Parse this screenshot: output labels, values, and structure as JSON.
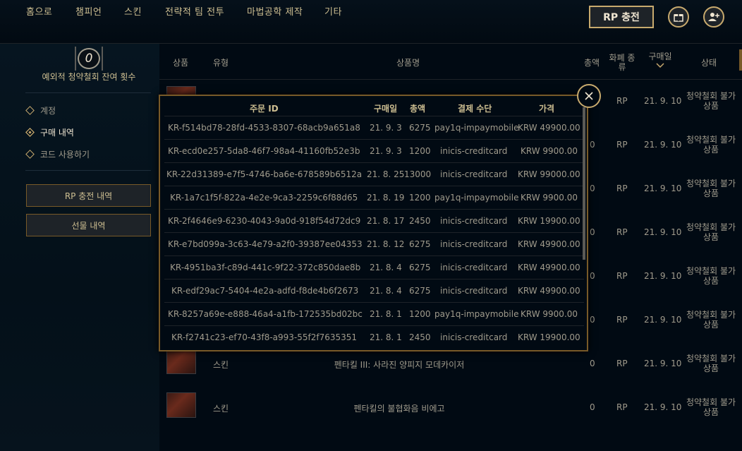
{
  "nav": {
    "items": [
      "홈으로",
      "챔피언",
      "스킨",
      "전략적 팀 전투",
      "마법공학 제작",
      "기타"
    ],
    "rp_button": "RP 충전",
    "gift_icon": "gift-icon",
    "friends_icon": "add-friend-icon"
  },
  "sidebar": {
    "refund_count": "0",
    "refund_label": "예외적 청약철회 잔여 횟수",
    "menu": [
      {
        "label": "계정",
        "active": false
      },
      {
        "label": "구매 내역",
        "active": true
      },
      {
        "label": "코드 사용하기",
        "active": false
      }
    ],
    "rp_history_button": "RP 충전 내역",
    "gift_history_button": "선물 내역"
  },
  "table": {
    "headers": {
      "item": "상품",
      "type": "유형",
      "name": "상품명",
      "total": "총액",
      "currency": "화폐 종류",
      "date": "구매일",
      "status": "상태"
    },
    "rows": [
      {
        "type": "",
        "name": "",
        "total": "",
        "currency": "RP",
        "date": "21. 9. 10",
        "status": "청약철회 불가 상품"
      },
      {
        "type": "",
        "name": "",
        "total": "0",
        "currency": "RP",
        "date": "21. 9. 10",
        "status": "청약철회 불가 상품"
      },
      {
        "type": "",
        "name": "",
        "total": "0",
        "currency": "RP",
        "date": "21. 9. 10",
        "status": "청약철회 불가 상품"
      },
      {
        "type": "",
        "name": "",
        "total": "0",
        "currency": "RP",
        "date": "21. 9. 10",
        "status": "청약철회 불가 상품"
      },
      {
        "type": "",
        "name": "",
        "total": "0",
        "currency": "RP",
        "date": "21. 9. 10",
        "status": "청약철회 불가 상품"
      },
      {
        "type": "",
        "name": "",
        "total": "0",
        "currency": "RP",
        "date": "21. 9. 10",
        "status": "청약철회 불가 상품"
      },
      {
        "type": "스킨",
        "name": "펜타킬 III: 사라진 양피지 모데카이저",
        "total": "0",
        "currency": "RP",
        "date": "21. 9. 10",
        "status": "청약철회 불가 상품"
      },
      {
        "type": "스킨",
        "name": "펜타킬의 불협화음 비에고",
        "total": "0",
        "currency": "RP",
        "date": "21. 9. 10",
        "status": "청약철회 불가 상품"
      }
    ]
  },
  "modal": {
    "headers": {
      "order_id": "주문 ID",
      "date": "구매일",
      "total": "총액",
      "method": "결제 수단",
      "price": "가격"
    },
    "rows": [
      {
        "order_id": "KR-f514bd78-28fd-4533-8307-68acb9a651a8",
        "date": "21. 9. 3",
        "total": "6275",
        "method": "pay1q-impaymobile",
        "price": "KRW 49900.00"
      },
      {
        "order_id": "KR-ecd0e257-5da8-46f7-98a4-41160fb52e3b",
        "date": "21. 9. 3",
        "total": "1200",
        "method": "inicis-creditcard",
        "price": "KRW 9900.00"
      },
      {
        "order_id": "KR-22d31389-e7f5-4746-ba6e-678589b6512a",
        "date": "21. 8. 25",
        "total": "13000",
        "method": "inicis-creditcard",
        "price": "KRW 99000.00"
      },
      {
        "order_id": "KR-1a7c1f5f-822a-4e2e-9ca3-2259c6f88d65",
        "date": "21. 8. 19",
        "total": "1200",
        "method": "pay1q-impaymobile",
        "price": "KRW 9900.00"
      },
      {
        "order_id": "KR-2f4646e9-6230-4043-9a0d-918f54d72dc9",
        "date": "21. 8. 17",
        "total": "2450",
        "method": "inicis-creditcard",
        "price": "KRW 19900.00"
      },
      {
        "order_id": "KR-e7bd099a-3c63-4e79-a2f0-39387ee04353",
        "date": "21. 8. 12",
        "total": "6275",
        "method": "inicis-creditcard",
        "price": "KRW 49900.00"
      },
      {
        "order_id": "KR-4951ba3f-c89d-441c-9f22-372c850dae8b",
        "date": "21. 8. 4",
        "total": "6275",
        "method": "inicis-creditcard",
        "price": "KRW 49900.00"
      },
      {
        "order_id": "KR-edf29ac7-5404-4e2a-adfd-f8de4b6f2673",
        "date": "21. 8. 4",
        "total": "6275",
        "method": "inicis-creditcard",
        "price": "KRW 49900.00"
      },
      {
        "order_id": "KR-8257a69e-e888-46a4-a1fb-172535bd02bc",
        "date": "21. 8. 1",
        "total": "1200",
        "method": "pay1q-impaymobile",
        "price": "KRW 9900.00"
      },
      {
        "order_id": "KR-f2741c23-ef70-43f8-a993-55f2f7635351",
        "date": "21. 8. 1",
        "total": "2450",
        "method": "inicis-creditcard",
        "price": "KRW 19900.00"
      }
    ],
    "close_icon": "close-icon"
  }
}
